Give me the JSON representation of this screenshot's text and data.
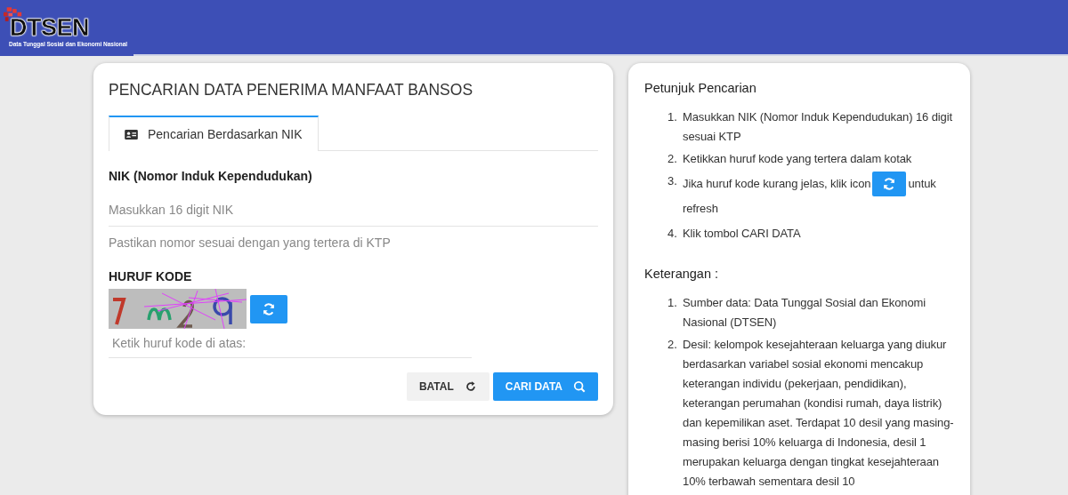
{
  "header": {
    "logo_text": "DTSEN",
    "logo_subtitle": "Data Tunggal Sosial dan Ekonomi Nasional"
  },
  "search_card": {
    "title": "PENCARIAN DATA PENERIMA MANFAAT BANSOS",
    "tabs": [
      {
        "label": "Pencarian Berdasarkan NIK",
        "selected": true
      }
    ],
    "nik_label": "NIK (Nomor Induk Kependudukan)",
    "nik_placeholder": "Masukkan 16 digit NIK",
    "nik_hint": "Pastikan nomor sesuai dengan yang tertera di KTP",
    "code_label": "HURUF KODE",
    "code_placeholder": "Ketik huruf kode di atas:",
    "buttons": [
      {
        "label": "BATAL",
        "kind": "reset"
      },
      {
        "label": "CARI DATA",
        "kind": "search"
      }
    ]
  },
  "help_card": {
    "sections": [
      {
        "title": "Petunjuk Pencarian",
        "items": [
          {
            "number": "1.",
            "text": "Masukkan NIK (Nomor Induk Kependudukan) 16 digit sesuai KTP"
          },
          {
            "number": "2.",
            "text": "Ketikkan huruf kode yang tertera dalam kotak"
          },
          {
            "number": "3.",
            "text": "Jika huruf kode kurang jelas, klik icon",
            "kind": "refresh-icon",
            "text_after": "untuk",
            "text_next_line": "refresh"
          },
          {
            "number": "4.",
            "text": "Klik tombol CARI DATA"
          }
        ]
      },
      {
        "title": "Keterangan :",
        "items": [
          {
            "number": "1.",
            "text": "Sumber data: Data Tunggal Sosial dan Ekonomi Nasional (DTSEN)"
          },
          {
            "number": "2.",
            "text": "Desil: kelompok kesejahteraan keluarga yang diukur berdasarkan variabel sosial ekonomi mencakup keterangan individu (pekerjaan, pendidikan), keterangan perumahan (kondisi rumah, daya listrik) dan kepemilikan aset. Terdapat 10 desil yang masing-masing berisi 10% keluarga di Indonesia, desil 1 merupakan keluarga dengan tingkat kesejahteraan 10% terbawah sementara desil 10"
          }
        ]
      }
    ]
  }
}
